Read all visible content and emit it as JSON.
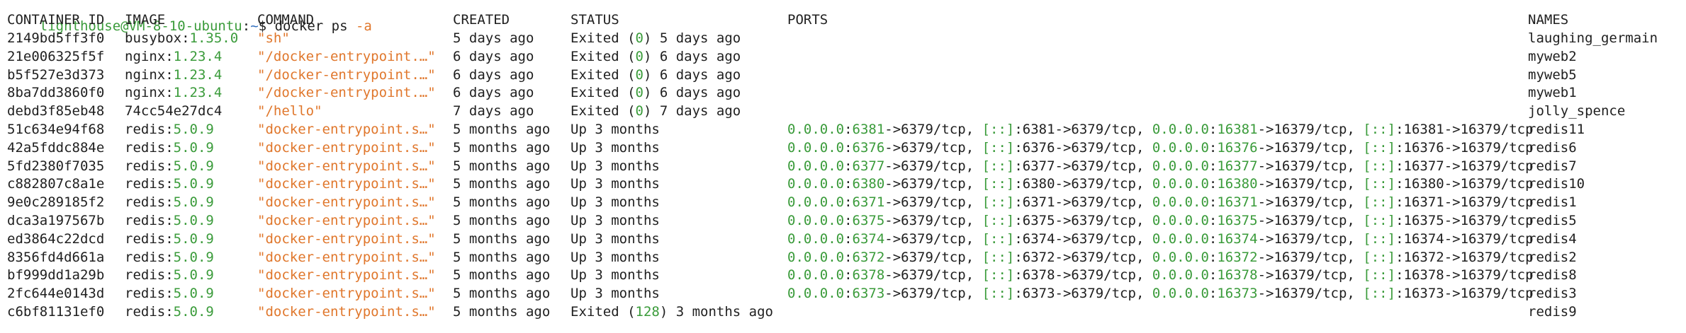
{
  "prompt": {
    "user_host": "lighthouse@VM-8-10-ubuntu",
    "path": "~",
    "symbol": "$",
    "command": "docker ps",
    "flag": "-a"
  },
  "headers": {
    "container_id": "CONTAINER ID",
    "image": "IMAGE",
    "command": "COMMAND",
    "created": "CREATED",
    "status": "STATUS",
    "ports": "PORTS",
    "names": "NAMES"
  },
  "rows": [
    {
      "id": "2149bd5ff3f0",
      "image_name": "busybox:",
      "image_tag": "1.35.0",
      "command": "\"sh\"",
      "created": "5 days ago",
      "status_pre": "Exited (",
      "status_code": "0",
      "status_post": ") 5 days ago",
      "ports": [],
      "name": "laughing_germain"
    },
    {
      "id": "21e006325f5f",
      "image_name": "nginx:",
      "image_tag": "1.23.4",
      "command": "\"/docker-entrypoint.…\"",
      "created": "6 days ago",
      "status_pre": "Exited (",
      "status_code": "0",
      "status_post": ") 6 days ago",
      "ports": [],
      "name": "myweb2"
    },
    {
      "id": "b5f527e3d373",
      "image_name": "nginx:",
      "image_tag": "1.23.4",
      "command": "\"/docker-entrypoint.…\"",
      "created": "6 days ago",
      "status_pre": "Exited (",
      "status_code": "0",
      "status_post": ") 6 days ago",
      "ports": [],
      "name": "myweb5"
    },
    {
      "id": "8ba7dd3860f0",
      "image_name": "nginx:",
      "image_tag": "1.23.4",
      "command": "\"/docker-entrypoint.…\"",
      "created": "6 days ago",
      "status_pre": "Exited (",
      "status_code": "0",
      "status_post": ") 6 days ago",
      "ports": [],
      "name": "myweb1"
    },
    {
      "id": "debd3f85eb48",
      "image_name": "74cc54e27dc4",
      "image_tag": "",
      "command": "\"/hello\"",
      "created": "7 days ago",
      "status_pre": "Exited (",
      "status_code": "0",
      "status_post": ") 7 days ago",
      "ports": [],
      "name": "jolly_spence"
    },
    {
      "id": "51c634e94f68",
      "image_name": "redis:",
      "image_tag": "5.0.9",
      "command": "\"docker-entrypoint.s…\"",
      "created": "5 months ago",
      "status_pre": "Up 3 months",
      "status_code": "",
      "status_post": "",
      "ports": [
        "6381",
        "6381",
        "16381",
        "16381"
      ],
      "name": "redis11"
    },
    {
      "id": "42a5fddc884e",
      "image_name": "redis:",
      "image_tag": "5.0.9",
      "command": "\"docker-entrypoint.s…\"",
      "created": "5 months ago",
      "status_pre": "Up 3 months",
      "status_code": "",
      "status_post": "",
      "ports": [
        "6376",
        "6376",
        "16376",
        "16376"
      ],
      "name": "redis6"
    },
    {
      "id": "5fd2380f7035",
      "image_name": "redis:",
      "image_tag": "5.0.9",
      "command": "\"docker-entrypoint.s…\"",
      "created": "5 months ago",
      "status_pre": "Up 3 months",
      "status_code": "",
      "status_post": "",
      "ports": [
        "6377",
        "6377",
        "16377",
        "16377"
      ],
      "name": "redis7"
    },
    {
      "id": "c882807c8a1e",
      "image_name": "redis:",
      "image_tag": "5.0.9",
      "command": "\"docker-entrypoint.s…\"",
      "created": "5 months ago",
      "status_pre": "Up 3 months",
      "status_code": "",
      "status_post": "",
      "ports": [
        "6380",
        "6380",
        "16380",
        "16380"
      ],
      "name": "redis10"
    },
    {
      "id": "9e0c289185f2",
      "image_name": "redis:",
      "image_tag": "5.0.9",
      "command": "\"docker-entrypoint.s…\"",
      "created": "5 months ago",
      "status_pre": "Up 3 months",
      "status_code": "",
      "status_post": "",
      "ports": [
        "6371",
        "6371",
        "16371",
        "16371"
      ],
      "name": "redis1"
    },
    {
      "id": "dca3a197567b",
      "image_name": "redis:",
      "image_tag": "5.0.9",
      "command": "\"docker-entrypoint.s…\"",
      "created": "5 months ago",
      "status_pre": "Up 3 months",
      "status_code": "",
      "status_post": "",
      "ports": [
        "6375",
        "6375",
        "16375",
        "16375"
      ],
      "name": "redis5"
    },
    {
      "id": "ed3864c22dcd",
      "image_name": "redis:",
      "image_tag": "5.0.9",
      "command": "\"docker-entrypoint.s…\"",
      "created": "5 months ago",
      "status_pre": "Up 3 months",
      "status_code": "",
      "status_post": "",
      "ports": [
        "6374",
        "6374",
        "16374",
        "16374"
      ],
      "name": "redis4"
    },
    {
      "id": "8356fd4d661a",
      "image_name": "redis:",
      "image_tag": "5.0.9",
      "command": "\"docker-entrypoint.s…\"",
      "created": "5 months ago",
      "status_pre": "Up 3 months",
      "status_code": "",
      "status_post": "",
      "ports": [
        "6372",
        "6372",
        "16372",
        "16372"
      ],
      "name": "redis2"
    },
    {
      "id": "bf999dd1a29b",
      "image_name": "redis:",
      "image_tag": "5.0.9",
      "command": "\"docker-entrypoint.s…\"",
      "created": "5 months ago",
      "status_pre": "Up 3 months",
      "status_code": "",
      "status_post": "",
      "ports": [
        "6378",
        "6378",
        "16378",
        "16378"
      ],
      "name": "redis8"
    },
    {
      "id": "2fc644e0143d",
      "image_name": "redis:",
      "image_tag": "5.0.9",
      "command": "\"docker-entrypoint.s…\"",
      "created": "5 months ago",
      "status_pre": "Up 3 months",
      "status_code": "",
      "status_post": "",
      "ports": [
        "6373",
        "6373",
        "16373",
        "16373"
      ],
      "name": "redis3"
    },
    {
      "id": "c6bf81131ef0",
      "image_name": "redis:",
      "image_tag": "5.0.9",
      "command": "\"docker-entrypoint.s…\"",
      "created": "5 months ago",
      "status_pre": "Exited (",
      "status_code": "128",
      "status_post": ") 3 months ago",
      "ports": [],
      "name": "redis9"
    }
  ],
  "port_strings": {
    "ipv4": "0.0.0.0",
    "ipv6": "[::]",
    "colon": ":",
    "container_port": "->6379/tcp",
    "container_bus_port": "->16379/tcp",
    "sep": ", "
  },
  "colors": {
    "green": "#3a9b3a",
    "orange": "#e0772c",
    "blue": "#2f6dbd",
    "text": "#1f1f1f",
    "background": "#ffffff"
  }
}
